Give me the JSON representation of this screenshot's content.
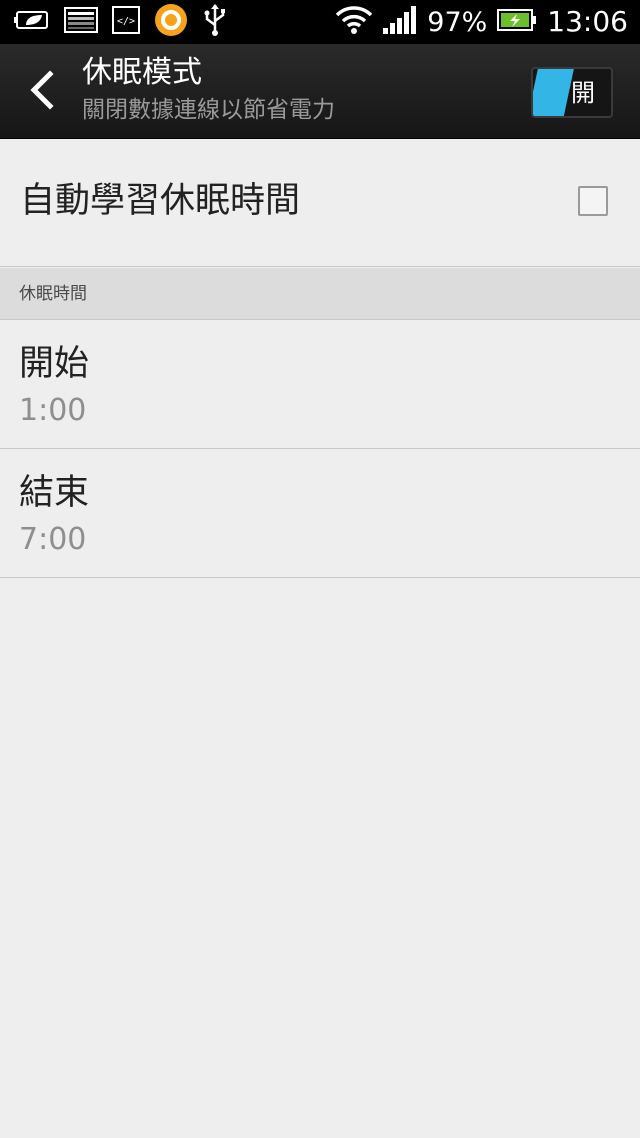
{
  "status_bar": {
    "icons_left": [
      "leaf-battery-icon",
      "image-notification-icon",
      "code-icon",
      "app-ring-icon",
      "usb-icon"
    ],
    "wifi_icon": "wifi-icon",
    "signal_icon": "signal-bars-icon",
    "battery_percent": "97%",
    "battery_icon": "battery-charging-icon",
    "time": "13:06"
  },
  "action_bar": {
    "back_icon": "back-arrow-icon",
    "title": "休眠模式",
    "subtitle": "關閉數據連線以節省電力",
    "toggle_label": "開",
    "toggle_state": "on",
    "accent_color": "#33b5e5"
  },
  "settings": {
    "auto_learn_label": "自動學習休眠時間",
    "auto_learn_checked": false,
    "section_header": "休眠時間",
    "start": {
      "label": "開始",
      "value": "1:00"
    },
    "end": {
      "label": "結束",
      "value": "7:00"
    }
  }
}
